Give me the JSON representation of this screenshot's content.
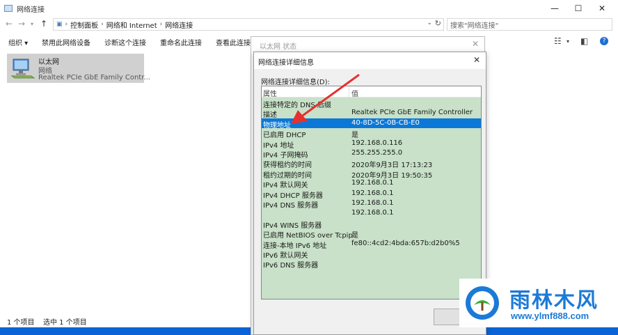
{
  "window": {
    "title": "网络连接",
    "min": "—",
    "max": "☐",
    "close": "✕"
  },
  "address": {
    "breadcrumb": [
      "控制面板",
      "网络和 Internet",
      "网络连接"
    ],
    "search_placeholder": "搜索\"网络连接\""
  },
  "toolbar": {
    "items": [
      "组织 ▾",
      "禁用此网络设备",
      "诊断这个连接",
      "重命名此连接",
      "查看此连接"
    ]
  },
  "adapter": {
    "name": "以太网",
    "status": "网络",
    "device": "Realtek PCIe GbE Family Contr..."
  },
  "statusbar": {
    "count": "1 个项目",
    "selected": "选中 1 个项目"
  },
  "status_dialog": {
    "title": "以太网 状态"
  },
  "details_dialog": {
    "title": "网络连接详细信息",
    "label": "网络连接详细信息(D):",
    "col_property": "属性",
    "col_value": "值",
    "rows": [
      {
        "p": "连接特定的 DNS 后缀",
        "v": ""
      },
      {
        "p": "描述",
        "v": "Realtek PCIe GbE Family Controller"
      },
      {
        "p": "物理地址",
        "v": "40-8D-5C-0B-CB-E0",
        "selected": true
      },
      {
        "p": "已启用 DHCP",
        "v": "是"
      },
      {
        "p": "IPv4 地址",
        "v": "192.168.0.116"
      },
      {
        "p": "IPv4 子网掩码",
        "v": "255.255.255.0"
      },
      {
        "p": "获得租约的时间",
        "v": "2020年9月3日 17:13:23"
      },
      {
        "p": "租约过期的时间",
        "v": "2020年9月3日 19:50:35"
      },
      {
        "p": "IPv4 默认网关",
        "v": "192.168.0.1"
      },
      {
        "p": "IPv4 DHCP 服务器",
        "v": "192.168.0.1"
      },
      {
        "p": "IPv4 DNS 服务器",
        "v": "192.168.0.1"
      },
      {
        "p": "",
        "v": "192.168.0.1"
      },
      {
        "p": "IPv4 WINS 服务器",
        "v": ""
      },
      {
        "p": "已启用 NetBIOS over Tcpip",
        "v": "是"
      },
      {
        "p": "连接-本地 IPv6 地址",
        "v": "fe80::4cd2:4bda:657b:d2b0%5"
      },
      {
        "p": "IPv6 默认网关",
        "v": ""
      },
      {
        "p": "IPv6 DNS 服务器",
        "v": ""
      }
    ]
  },
  "watermark": {
    "text": "雨林木风",
    "url": "www.ylmf888.com"
  },
  "colors": {
    "grid_bg": "#c8e1c8",
    "selection": "#0b78d7",
    "arrow": "#e53030",
    "brand": "#1c7ad6"
  }
}
